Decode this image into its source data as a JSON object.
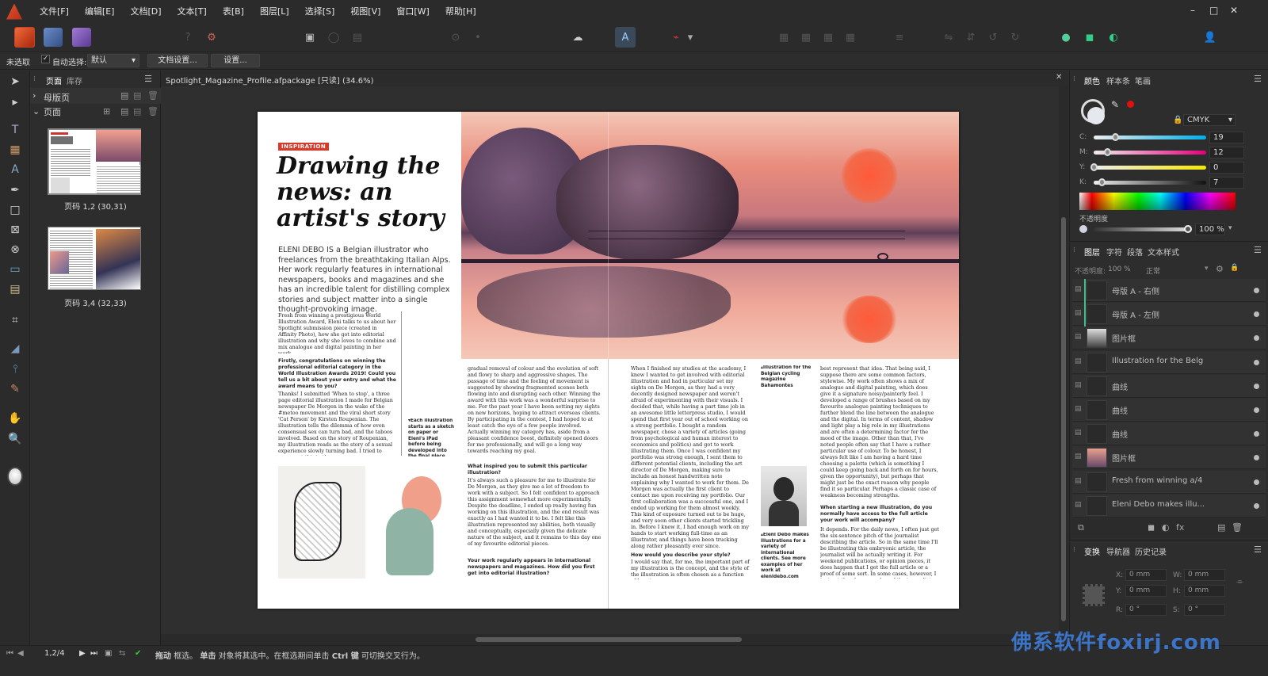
{
  "menubar": {
    "items": [
      "文件[F]",
      "编辑[E]",
      "文档[D]",
      "文本[T]",
      "表[B]",
      "图层[L]",
      "选择[S]",
      "视图[V]",
      "窗口[W]",
      "帮助[H]"
    ],
    "window_controls": [
      "–",
      "□",
      "✕"
    ]
  },
  "contextbar": {
    "selection": "未选取",
    "auto_select_label": "自动选择:",
    "auto_select_value": "默认",
    "doc_setup": "文档设置...",
    "settings": "设置..."
  },
  "pages_panel": {
    "tabs": [
      "页面",
      "库存"
    ],
    "master_label": "母版页",
    "pages_label": "页面",
    "thumbs": [
      {
        "label": "页码 1,2 (30,31)"
      },
      {
        "label": "页码 3,4 (32,33)"
      }
    ]
  },
  "document": {
    "tab_title": "Spotlight_Magazine_Profile.afpackage [只读] (34.6%)",
    "close": "✕"
  },
  "article": {
    "tag": "INSPIRATION",
    "headline": "Drawing the news: an artist's story",
    "standfirst": "ELENI DEBO IS a Belgian illustrator who freelances from the breathtaking Italian Alps. Her work regularly features in international newspapers, books and magazines and she has an incredible talent for distilling complex stories and subject matter into a single thought-provoking image.",
    "intro": "Fresh from winning a prestigious World Illustration Award, Eleni talks to us about her Spotlight submission piece (created in Affinity Photo), how she got into editorial illustration and why she loves to combine and mix analogue and digital painting in her work.",
    "q1": "Firstly, congratulations on winning the professional editorial category in the World Illustration Awards 2019! Could you tell us a bit about your entry and what the award means to you?",
    "a1": "Thanks! I submitted 'When to stop', a three page editorial illustration I made for Belgian newspaper De Morgen in the wake of the #metoo movement and the viral short story 'Cat Person' by Kirsten Roupenian. The illustration tells the dilemma of how even consensual sex can turn bad, and the taboos involved. Based on the story of Roupenian, my illustration reads as the story of a sexual experience slowly turning bad. I tried to represent this in the",
    "caption1": "▾Each illustration starts as a sketch on paper or Eleni's iPad before being developed into the final piece",
    "col2": "gradual removal of colour and the evolution of soft and flowy to sharp and aggressive shapes. The passage of time and the feeling of movement is suggested by showing fragmented scenes both flowing into and disrupting each other. Winning the award with this work was a wonderful surprise to me. For the past year I have been setting my sights on new horizons, hoping to attract overseas clients. By participating in the contest, I had hoped to at least catch the eye of a few people involved. Actually winning my category has, aside from a pleasant confidence boost, definitely opened doors for me professionally, and will go a long way towards reaching my goal.",
    "q2": "What inspired you to submit this particular illustration?",
    "a2": "It's always such a pleasure for me to illustrate for De Morgen, as they give me a lot of freedom to work with a subject. So I felt confident to approach this assignment somewhat more experimentally. Despite the deadline, I ended up really having fun working on this illustration, and the end result was exactly as I had wanted it to be. I felt like this illustration represented my abilities, both visually and conceptually, especially given the delicate nature of the subject, and it remains to this day one of my favourite editorial pieces.",
    "q3": "Your work regularly appears in international newspapers and magazines. How did you first get into editorial illustration?",
    "col3": "When I finished my studies at the academy, I knew I wanted to get involved with editorial illustration and had in particular set my sights on De Morgen, as they had a very decently designed newspaper and weren't afraid of experimenting with their visuals. I decided that, while having a part time job in an awesome little letterpress studio, I would spend that first year out of school working on a strong portfolio. I bought a random newspaper, chose a variety of articles (going from psychological and human interest to economics and politics) and got to work illustrating them. Once I was confident my portfolio was strong enough, I sent them to different potential clients, including the art director of De Morgen, making sure to include an honest handwritten note explaining why I wanted to work for them. De Morgen was actually the first client to contact me upon receiving my portfolio. Our first collaboration was a successful one, and I ended up working for them almost weekly. This kind of exposure turned out to be huge, and very soon other clients started trickling in. Before I knew it, I had enough work on my hands to start working full-time as an illustrator, and things have been trucking along rather pleasantly ever since.",
    "q4": "How would you describe your style?",
    "a4": "I would say that, for me, the important part of my illustration is the concept, and the style of the illustration is often chosen as a function of how to",
    "caption2": "▴Illustration for the Belgian cycling magazine Bahamontes",
    "caption3": "▴Eleni Debo makes illustrations for a variety of international clients. See more examples of her work at elenidebo.com",
    "col4": "best represent that idea. That being said, I suppose there are some common factors, stylewise. My work often shows a mix of analogue and digital painting, which does give it a signature noisy/painterly feel. I developed a range of brushes based on my favourite analogue painting techniques to further blend the line between the analogue and the digital. In terms of content, shadow and light play a big role in my illustrations and are often a determining factor for the mood of the image. Other than that, I've noted people often say that I have a rather particular use of colour. To be honest, I always felt like I am having a hard time choosing a palette (which is something I could keep going back and forth on for hours, given the opportunity), but perhaps that might just be the exact reason why people find it so particular. Perhaps a classic case of weakness becoming strengths.",
    "q5": "When starting a new illustration, do you normally have access to the full article your work will accompany?",
    "a5": "It depends. For the daily news, I often just get the six-sentence pitch of the journalist describing the article. So in the same time I'll be illustrating this embryonic article, the journalist will be actually writing it. For weekend publications, or opinion pieces, it does happen that I get the full article or a proof of some sort. In some cases, however, I just get the phone number of the journalist and the"
  },
  "color_panel": {
    "tabs": [
      "颜色",
      "样本条",
      "笔画"
    ],
    "mode": "CMYK",
    "channels": [
      {
        "label": "C:",
        "value": "19",
        "fraction": 0.19,
        "gradient": "linear-gradient(90deg,#eee,#00aee8)"
      },
      {
        "label": "M:",
        "value": "12",
        "fraction": 0.12,
        "gradient": "linear-gradient(90deg,#eee,#e4007c)"
      },
      {
        "label": "Y:",
        "value": "0",
        "fraction": 0.0,
        "gradient": "linear-gradient(90deg,#eee,#f6e500)"
      },
      {
        "label": "K:",
        "value": "7",
        "fraction": 0.07,
        "gradient": "linear-gradient(90deg,#eee,#111)"
      }
    ],
    "opacity_label": "不透明度",
    "opacity_value": "100 %"
  },
  "layers_panel": {
    "tabs": [
      "图层",
      "字符",
      "段落",
      "文本样式"
    ],
    "opacity_label": "不透明度:",
    "opacity_value": "100 %",
    "blend_mode": "正常",
    "layers": [
      {
        "name": "母版 A - 右侧",
        "thumb": "dark"
      },
      {
        "name": "母版 A - 左侧",
        "thumb": "dark"
      },
      {
        "name": "图片框",
        "thumb": "portrait"
      },
      {
        "name": "Illustration for the Belg",
        "thumb": "dark"
      },
      {
        "name": "曲线",
        "thumb": "dark"
      },
      {
        "name": "曲线",
        "thumb": "dark"
      },
      {
        "name": "曲线",
        "thumb": "dark"
      },
      {
        "name": "图片框",
        "thumb": "pink"
      },
      {
        "name": "Fresh from winning a/4",
        "thumb": "dark"
      },
      {
        "name": "Eleni Debo makes illu...",
        "thumb": "dark"
      }
    ]
  },
  "transform_panel": {
    "tabs": [
      "变换",
      "导航器",
      "历史记录"
    ],
    "x_label": "X:",
    "x": "0 mm",
    "w_label": "W:",
    "w": "0 mm",
    "y_label": "Y:",
    "y": "0 mm",
    "h_label": "H:",
    "h": "0 mm",
    "r_label": "R:",
    "r": "0 °",
    "s_label": "S:",
    "s": "0 °"
  },
  "statusbar": {
    "page": "1,2/4",
    "hint_prefix": "拖动",
    "hint_1": "框选。",
    "hint_click": "单击",
    "hint_2": "对象将其选中。在框选期间单击",
    "hint_key": "Ctrl 键",
    "hint_3": "可切换交叉行为。"
  },
  "watermark": "佛系软件foxirj.com"
}
